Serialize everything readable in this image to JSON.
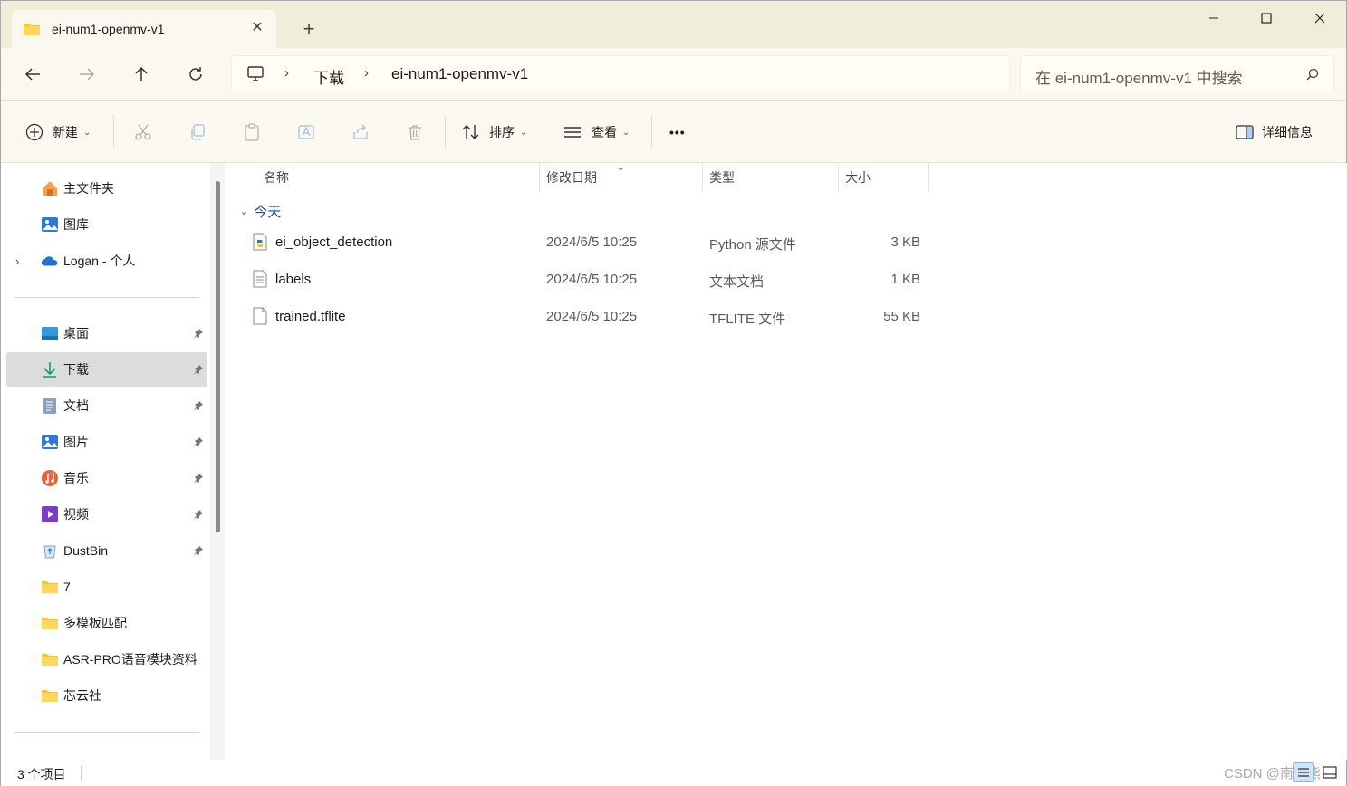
{
  "tab": {
    "title": "ei-num1-openmv-v1",
    "close": "✕",
    "new_tab": "+"
  },
  "window_controls": {
    "minimize": "minimize",
    "maximize": "maximize",
    "close": "close"
  },
  "address": {
    "crumbs": [
      "下载",
      "ei-num1-openmv-v1"
    ],
    "search_placeholder": "在 ei-num1-openmv-v1 中搜索"
  },
  "toolbar": {
    "new_label": "新建",
    "sort_label": "排序",
    "view_label": "查看",
    "more_label": "•••",
    "details_label": "详细信息"
  },
  "sidebar": {
    "top_items": [
      {
        "label": "主文件夹",
        "icon": "home-icon"
      },
      {
        "label": "图库",
        "icon": "gallery-icon"
      },
      {
        "label": "Logan - 个人",
        "icon": "onedrive-icon"
      }
    ],
    "pinned_items": [
      {
        "label": "桌面",
        "icon": "desktop-icon"
      },
      {
        "label": "下载",
        "icon": "download-icon",
        "selected": true
      },
      {
        "label": "文档",
        "icon": "document-icon"
      },
      {
        "label": "图片",
        "icon": "pictures-icon"
      },
      {
        "label": "音乐",
        "icon": "music-icon"
      },
      {
        "label": "视频",
        "icon": "video-icon"
      },
      {
        "label": "DustBin",
        "icon": "recycle-icon"
      },
      {
        "label": "7",
        "icon": "folder-icon"
      },
      {
        "label": "多模板匹配",
        "icon": "folder-icon"
      },
      {
        "label": "ASR-PRO语音模块资料",
        "icon": "folder-icon"
      },
      {
        "label": "芯云社",
        "icon": "folder-icon"
      }
    ]
  },
  "columns": {
    "name": "名称",
    "date": "修改日期",
    "type": "类型",
    "size": "大小"
  },
  "group": {
    "label": "今天"
  },
  "files": [
    {
      "name": "ei_object_detection",
      "date": "2024/6/5 10:25",
      "type": "Python 源文件",
      "size": "3 KB",
      "icon": "python-file-icon"
    },
    {
      "name": "labels",
      "date": "2024/6/5 10:25",
      "type": "文本文档",
      "size": "1 KB",
      "icon": "text-file-icon"
    },
    {
      "name": "trained.tflite",
      "date": "2024/6/5 10:25",
      "type": "TFLITE 文件",
      "size": "55 KB",
      "icon": "blank-file-icon"
    }
  ],
  "status": {
    "count": "3 个项目",
    "watermark": "CSDN @南极熊"
  }
}
